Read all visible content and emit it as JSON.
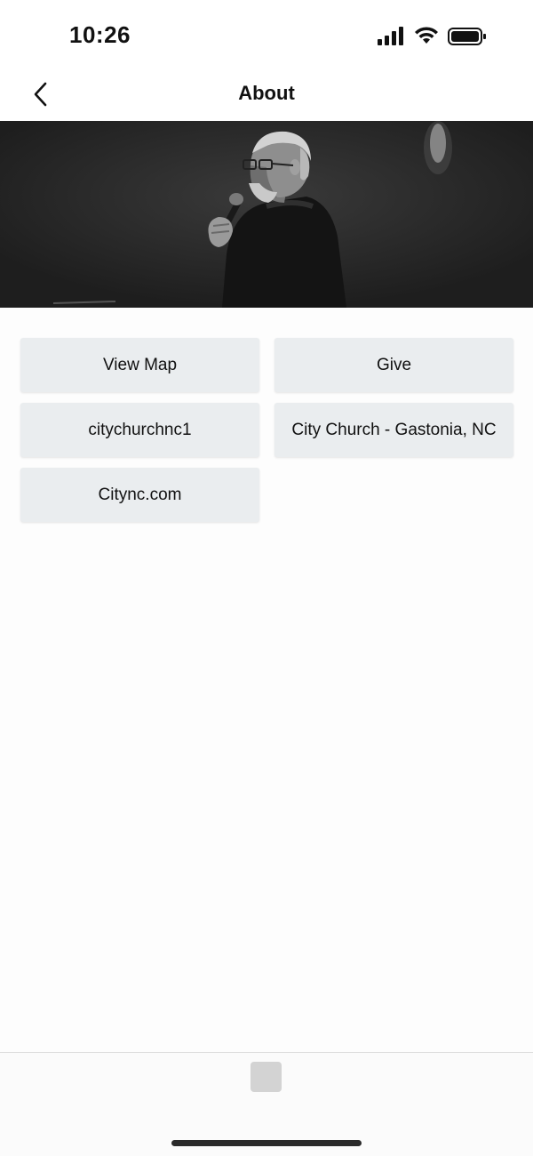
{
  "status_bar": {
    "time": "10:26",
    "icons": [
      "cellular-signal-icon",
      "wifi-icon",
      "battery-icon"
    ]
  },
  "nav": {
    "title": "About",
    "back_icon": "chevron-left-icon"
  },
  "hero": {
    "description_icon": "speaker-photo"
  },
  "tiles": [
    {
      "label": "View Map"
    },
    {
      "label": "Give"
    },
    {
      "label": "citychurchnc1"
    },
    {
      "label": "City Church - Gastonia, NC"
    },
    {
      "label": "Citync.com"
    }
  ],
  "colors": {
    "tile_bg": "#eaedef",
    "hero_bg": "#232323",
    "tab_placeholder": "#d3d3d3"
  }
}
